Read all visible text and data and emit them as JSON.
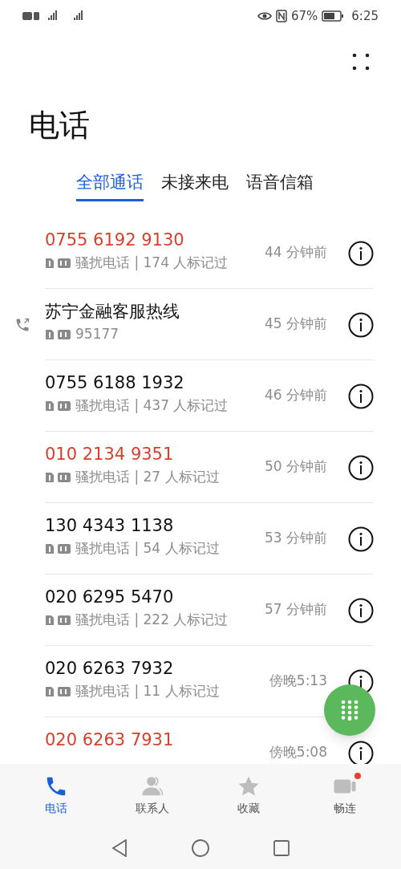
{
  "status_bar": {
    "battery_percent": "67%",
    "time": "6:25"
  },
  "title": "电话",
  "tabs": [
    {
      "label": "全部通话",
      "selected": true
    },
    {
      "label": "未接来电",
      "selected": false
    },
    {
      "label": "语音信箱",
      "selected": false
    }
  ],
  "calls": [
    {
      "name": "0755 6192 9130",
      "missed": true,
      "outgoing": false,
      "detail": "骚扰电话 | 174 人标记过",
      "time": "44 分钟前"
    },
    {
      "name": "苏宁金融客服热线",
      "missed": false,
      "outgoing": true,
      "detail": "95177",
      "time": "45 分钟前"
    },
    {
      "name": "0755 6188 1932",
      "missed": false,
      "outgoing": false,
      "detail": "骚扰电话 | 437 人标记过",
      "time": "46 分钟前"
    },
    {
      "name": "010 2134 9351",
      "missed": true,
      "outgoing": false,
      "detail": "骚扰电话 | 27 人标记过",
      "time": "50 分钟前"
    },
    {
      "name": "130 4343 1138",
      "missed": false,
      "outgoing": false,
      "detail": "骚扰电话 | 54 人标记过",
      "time": "53 分钟前"
    },
    {
      "name": "020 6295 5470",
      "missed": false,
      "outgoing": false,
      "detail": "骚扰电话 | 222 人标记过",
      "time": "57 分钟前"
    },
    {
      "name": "020 6263 7932",
      "missed": false,
      "outgoing": false,
      "detail": "骚扰电话 | 11 人标记过",
      "time": "傍晚5:13"
    },
    {
      "name": "020 6263 7931",
      "missed": true,
      "outgoing": false,
      "time": "傍晚5:08"
    }
  ],
  "bottom_nav": [
    {
      "kind": "phone",
      "label": "电话",
      "selected": true,
      "badge": false
    },
    {
      "kind": "contacts",
      "label": "联系人",
      "selected": false,
      "badge": false
    },
    {
      "kind": "favorites",
      "label": "收藏",
      "selected": false,
      "badge": false
    },
    {
      "kind": "connect",
      "label": "畅连",
      "selected": false,
      "badge": true
    }
  ]
}
